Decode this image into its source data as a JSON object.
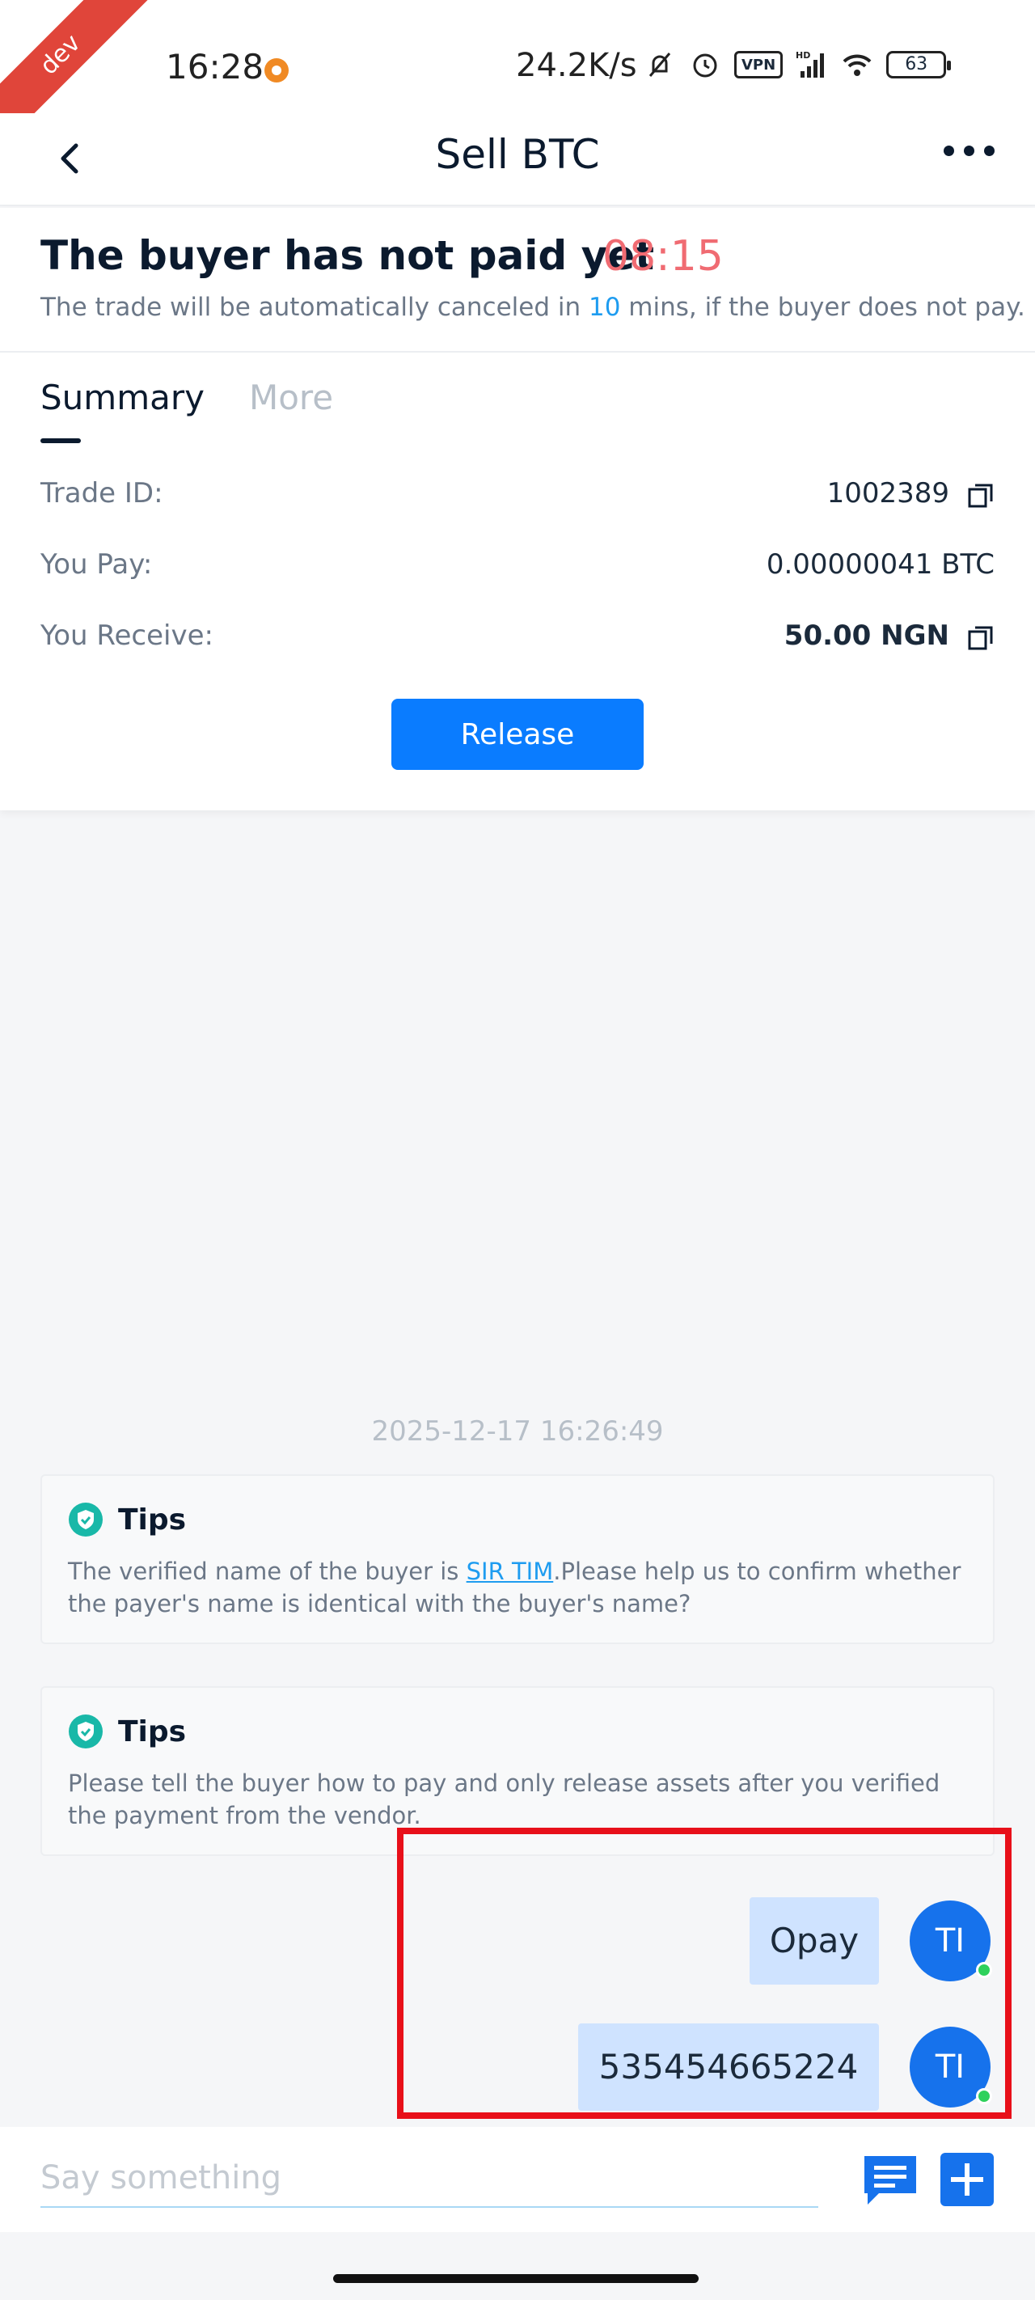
{
  "status_bar": {
    "ribbon": "dev",
    "time": "16:28",
    "speed": "24.2K/s",
    "vpn": "VPN",
    "network_label": "HD",
    "battery": "63"
  },
  "nav": {
    "title": "Sell BTC"
  },
  "trade": {
    "status": "The buyer has not paid yet",
    "countdown": "08:15",
    "cancel_prefix": "The trade will be automatically canceled in ",
    "cancel_minutes": "10",
    "cancel_suffix": " mins, if the buyer does not pay."
  },
  "tabs": [
    {
      "label": "Summary",
      "active": true
    },
    {
      "label": "More",
      "active": false
    }
  ],
  "summary": {
    "trade_id_label": "Trade ID:",
    "trade_id_value": "1002389",
    "you_pay_label": "You Pay:",
    "you_pay_value": "0.00000041 BTC",
    "you_receive_label": "You Receive:",
    "you_receive_value": "50.00 NGN"
  },
  "actions": {
    "release_label": "Release"
  },
  "chat": {
    "timestamp": "2025-12-17 16:26:49",
    "tips": [
      {
        "title": "Tips",
        "text_before": "The verified name of the buyer is ",
        "link": "SIR TIM",
        "text_after": ".Please help us to confirm whether the payer's name is identical with the buyer's name?"
      },
      {
        "title": "Tips",
        "text": "Please tell the buyer how to pay and only release assets after you verified the payment from the vendor."
      }
    ],
    "messages": [
      {
        "text": "Opay",
        "avatar": "TI"
      },
      {
        "text": "535454665224",
        "avatar": "TI"
      }
    ]
  },
  "input": {
    "placeholder": "Say something"
  },
  "colors": {
    "accent": "#0a7cff",
    "countdown": "#f06b72",
    "highlight_border": "#e8101a",
    "avatar": "#1672ec"
  }
}
